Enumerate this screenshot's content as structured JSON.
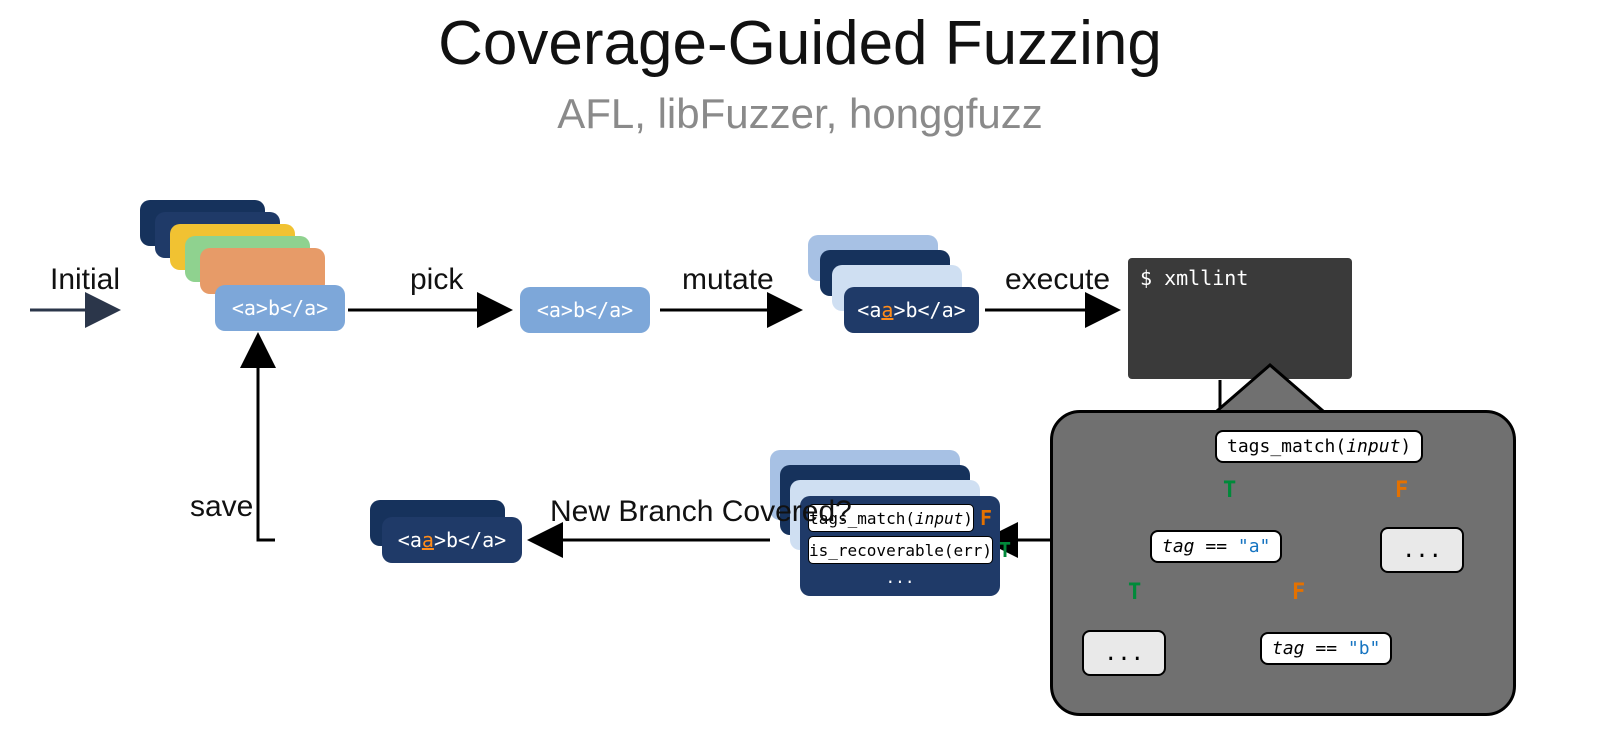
{
  "title": "Coverage-Guided Fuzzing",
  "subtitle": "AFL, libFuzzer, honggfuzz",
  "labels": {
    "initial": "Initial",
    "pick": "pick",
    "mutate": "mutate",
    "execute": "execute",
    "save": "save",
    "new_branch": "New Branch Covered?"
  },
  "seeds": {
    "corpus_front": "<a>b</a>",
    "picked": "<a>b</a>",
    "mutated_prefix": "<a",
    "mutated_a": "a",
    "mutated_suffix": ">b</a>",
    "saved_prefix": "<a",
    "saved_a": "a",
    "saved_suffix": ">b</a>"
  },
  "terminal": {
    "prompt": "$ xmllint"
  },
  "tree": {
    "root": "tags_match(",
    "root_arg": "input",
    "root_close": ")",
    "n_tag_a_pre": "tag",
    "n_tag_a_eq": " == ",
    "n_tag_a_val": "\"a\"",
    "n_tag_b_pre": "tag",
    "n_tag_b_eq": " == ",
    "n_tag_b_val": "\"b\"",
    "dots": "...",
    "T": "T",
    "F": "F"
  },
  "coverage": {
    "row1_pre": "tags_match(",
    "row1_arg": "input",
    "row1_close": ")",
    "row1_flag": "F",
    "row2": "is_recoverable(err)",
    "row2_flag": "T",
    "dots": "..."
  },
  "colors": {
    "stack1": "#16325c",
    "stack2": "#1f3a68",
    "stack3": "#f1c232",
    "stack4": "#8fd28f",
    "stack5": "#e79b68",
    "stack6": "#7da7d9",
    "mut_back1": "#a7c1e4",
    "mut_back2": "#16325c",
    "mut_back3": "#cfdff2",
    "mut_front": "#1f3a68",
    "cov_back1": "#a7c1e4",
    "cov_back2": "#16325c",
    "cov_back3": "#cfdff2",
    "cov_front": "#1f3a68",
    "save_back": "#16325c",
    "save_front": "#1f3a68"
  }
}
